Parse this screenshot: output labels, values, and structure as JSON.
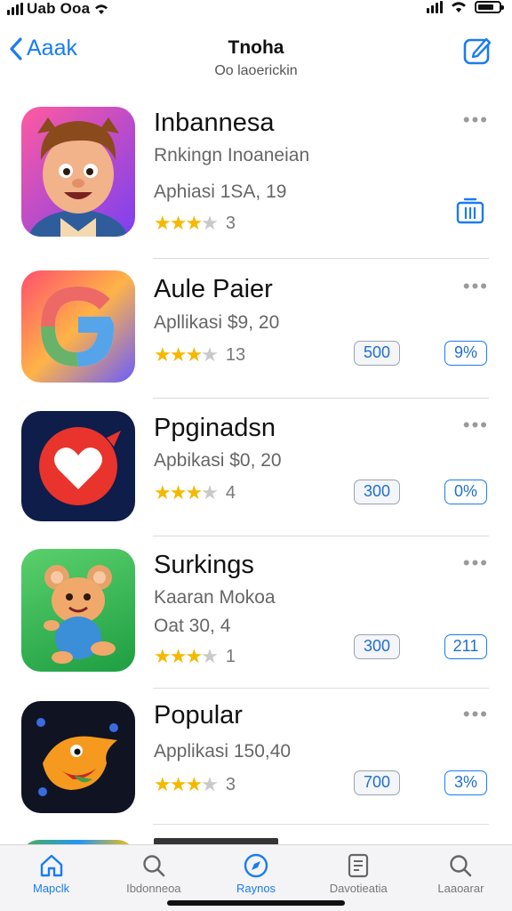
{
  "status_bar": {
    "carrier": "Uab Ooa",
    "icons": [
      "cellular-signal-icon",
      "wifi-icon",
      "battery-icon"
    ],
    "battery_level": 0.75
  },
  "nav": {
    "back_label": "Aaak",
    "title": "Tnoha",
    "subtitle": "Oo laoerickin",
    "compose_icon": "compose-icon"
  },
  "apps": [
    {
      "title": "Inbannesa",
      "subtitle": "Rnkingn Inoaneian",
      "meta": "Aphiasi 1SA, 19",
      "rating_count": "3",
      "stars": 3.5,
      "icon": "cartoon-boy-icon",
      "action": "trash-icon"
    },
    {
      "title": "Aule Paier",
      "subtitle": "Apllikasi  $9, 20",
      "rating_count": "13",
      "stars": 3.5,
      "icon": "colorful-g-icon",
      "badge_grey": "500",
      "badge_blue": "9%"
    },
    {
      "title": "Ppginadsn",
      "subtitle": "Apbikasi  $0, 20",
      "rating_count": "4",
      "stars": 3.5,
      "icon": "heart-bubble-icon",
      "badge_grey": "300",
      "badge_blue": "0%"
    },
    {
      "title": "Surkings",
      "subtitle": "Kaaran Mokoa",
      "meta": "Oat 30, 4",
      "rating_count": "1",
      "stars": 3.5,
      "icon": "cartoon-mouse-icon",
      "badge_grey": "300",
      "badge_blue": "211"
    },
    {
      "title": "Popular",
      "subtitle": "Applikasi 150,40",
      "rating_count": "3",
      "stars": 3.5,
      "icon": "orange-fish-icon",
      "badge_grey": "700",
      "badge_blue": "3%"
    }
  ],
  "tabs": [
    {
      "label": "Mapclk",
      "icon": "home-icon",
      "active": true
    },
    {
      "label": "Ibdonneoa",
      "icon": "search-icon",
      "active": false
    },
    {
      "label": "Raynos",
      "icon": "compass-icon",
      "active": true
    },
    {
      "label": "Davotieatia",
      "icon": "document-icon",
      "active": false
    },
    {
      "label": "Laaoarar",
      "icon": "search-icon",
      "active": false
    }
  ],
  "colors": {
    "accent": "#1a7cf2",
    "star": "#f5b800",
    "separator": "#dcdcdc"
  }
}
